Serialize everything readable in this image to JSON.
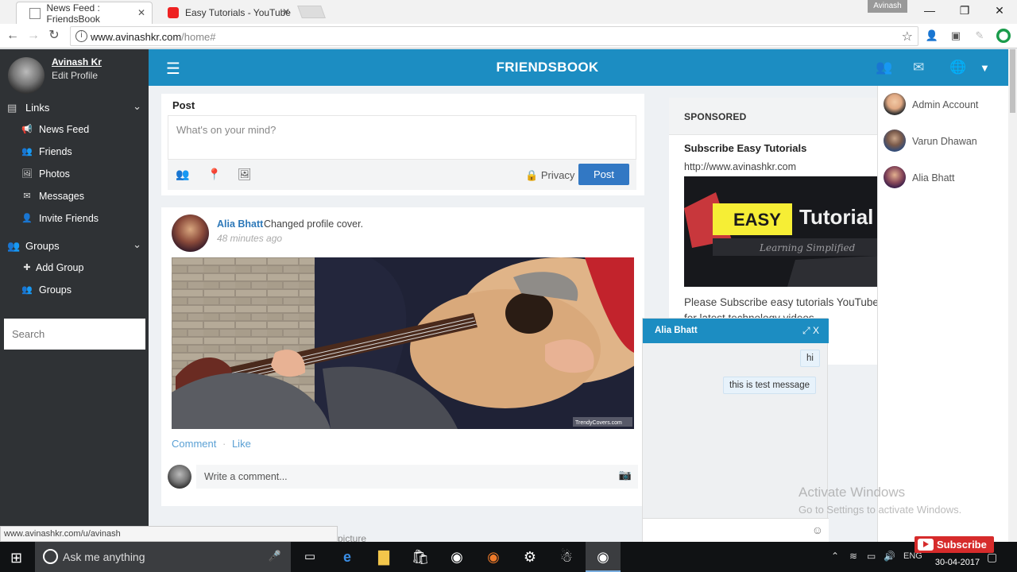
{
  "browser": {
    "tabs": [
      {
        "title": "News Feed : FriendsBook",
        "active": true
      },
      {
        "title": "Easy Tutorials - YouTube",
        "active": false
      }
    ],
    "profile_chip": "Avinash",
    "url_host": "www.avinashkr.com",
    "url_path": "/home#"
  },
  "sidebar": {
    "user_name": "Avinash Kr",
    "edit_profile": "Edit Profile",
    "sections": [
      {
        "label": "Links",
        "items": [
          "News Feed",
          "Friends",
          "Photos",
          "Messages",
          "Invite Friends"
        ]
      },
      {
        "label": "Groups",
        "items": [
          "Add Group",
          "Groups"
        ]
      }
    ],
    "search_placeholder": "Search"
  },
  "navbar": {
    "brand": "FRIENDSBOOK"
  },
  "composer": {
    "title": "Post",
    "placeholder": "What's on your mind?",
    "privacy_label": "Privacy",
    "post_button": "Post"
  },
  "feed_item": {
    "user": "Alia Bhatt",
    "action": "Changed profile cover.",
    "time": "48 minutes ago",
    "comment_label": "Comment",
    "separator": "·",
    "like_label": "Like",
    "comment_placeholder": "Write a comment...",
    "photo_watermark": "TrendyCovers.com"
  },
  "sponsored": {
    "header": "SPONSORED",
    "title": "Subscribe Easy Tutorials",
    "url": "http://www.avinashkr.com",
    "banner_text_1": "EASY",
    "banner_text_2": "Tutorial",
    "banner_tagline": "Learning Simplified",
    "description": "Please Subscribe easy tutorials YouTube",
    "description_2": "for latest technology videos"
  },
  "chat_list": [
    {
      "name": "Admin Account"
    },
    {
      "name": "Varun Dhawan"
    },
    {
      "name": "Alia Bhatt"
    }
  ],
  "chat_window": {
    "title": "Alia Bhatt",
    "messages": [
      "hi",
      "this is test message"
    ]
  },
  "status_url": "www.avinashkr.com/u/avinash",
  "peek_text": "picture",
  "watermark": {
    "line1": "Activate Windows",
    "line2": "Go to Settings to activate Windows."
  },
  "taskbar": {
    "search_placeholder": "Ask me anything",
    "lang": "ENG",
    "date": "30-04-2017"
  },
  "subscribe_badge": "Subscribe",
  "colors": {
    "navbar": "#1c8dc2",
    "sidebar": "#2f3235",
    "post_button": "#3278c4",
    "link": "#2e79b9"
  }
}
